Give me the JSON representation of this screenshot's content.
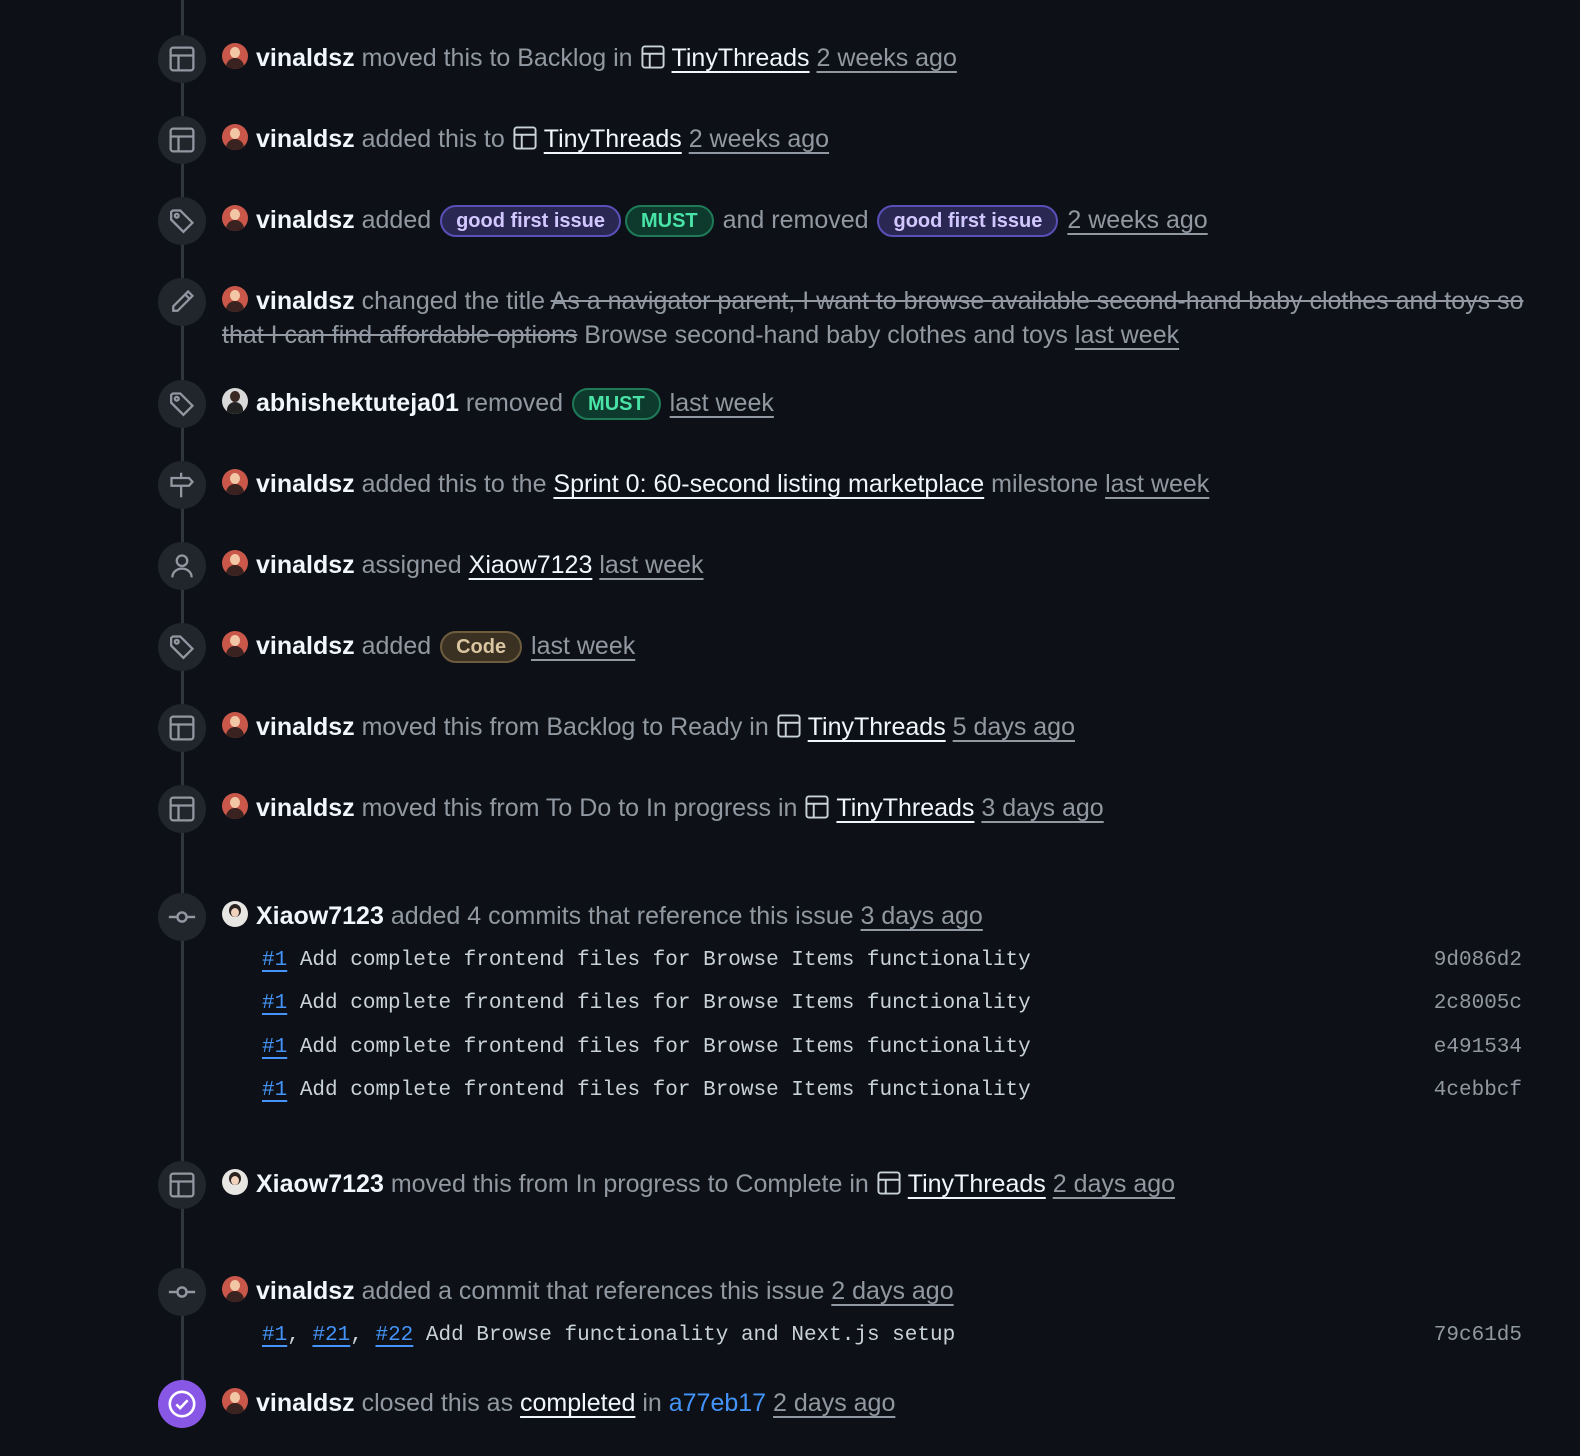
{
  "events": [
    {
      "user": "vinaldsz",
      "avatar": "v",
      "icon": "project",
      "parts": [
        {
          "t": "moved this to Backlog in "
        },
        {
          "p": "TinyThreads"
        },
        {
          "t": " "
        },
        {
          "time": "2 weeks ago"
        }
      ]
    },
    {
      "user": "vinaldsz",
      "avatar": "v",
      "icon": "project",
      "parts": [
        {
          "t": "added this to "
        },
        {
          "p": "TinyThreads"
        },
        {
          "t": " "
        },
        {
          "time": "2 weeks ago"
        }
      ]
    },
    {
      "user": "vinaldsz",
      "avatar": "v",
      "icon": "tag",
      "parts": [
        {
          "t": "added "
        },
        {
          "label": "good first issue",
          "c": "gfi"
        },
        {
          "label": "MUST",
          "c": "must"
        },
        {
          "t": " and removed "
        },
        {
          "label": "good first issue",
          "c": "gfi"
        },
        {
          "t": " "
        },
        {
          "time": "2 weeks ago"
        }
      ]
    },
    {
      "user": "vinaldsz",
      "avatar": "v",
      "icon": "pencil",
      "wrap": true,
      "parts": [
        {
          "t": "changed the title "
        },
        {
          "s": "As a navigator parent, I want to browse available second-hand baby clothes and toys so that I can find affordable options"
        },
        {
          "t": " Browse second-hand baby clothes and toys "
        },
        {
          "time": "last week"
        }
      ]
    },
    {
      "user": "abhishektuteja01",
      "avatar": "a",
      "icon": "tag",
      "parts": [
        {
          "t": "removed "
        },
        {
          "label": "MUST",
          "c": "must"
        },
        {
          "t": " "
        },
        {
          "time": "last week"
        }
      ]
    },
    {
      "user": "vinaldsz",
      "avatar": "v",
      "icon": "milestone",
      "parts": [
        {
          "t": "added this to the "
        },
        {
          "l": "Sprint 0: 60-second listing marketplace"
        },
        {
          "t": " milestone "
        },
        {
          "time": "last week"
        }
      ]
    },
    {
      "user": "vinaldsz",
      "avatar": "v",
      "icon": "person",
      "parts": [
        {
          "t": "assigned "
        },
        {
          "l": "Xiaow7123"
        },
        {
          "t": " "
        },
        {
          "time": "last week"
        }
      ]
    },
    {
      "user": "vinaldsz",
      "avatar": "v",
      "icon": "tag",
      "parts": [
        {
          "t": "added "
        },
        {
          "label": "Code",
          "c": "code"
        },
        {
          "t": " "
        },
        {
          "time": "last week"
        }
      ]
    },
    {
      "user": "vinaldsz",
      "avatar": "v",
      "icon": "project",
      "parts": [
        {
          "t": "moved this from Backlog to Ready in "
        },
        {
          "p": "TinyThreads"
        },
        {
          "t": " "
        },
        {
          "time": "5 days ago"
        }
      ]
    },
    {
      "user": "vinaldsz",
      "avatar": "v",
      "icon": "project",
      "parts": [
        {
          "t": "moved this from To Do to In progress in "
        },
        {
          "p": "TinyThreads"
        },
        {
          "t": " "
        },
        {
          "time": "3 days ago"
        }
      ]
    },
    {
      "user": "Xiaow7123",
      "avatar": "x",
      "icon": "commit",
      "parts": [
        {
          "t": "added 4 commits that reference this issue "
        },
        {
          "time": "3 days ago"
        }
      ]
    },
    {
      "user": "Xiaow7123",
      "avatar": "x",
      "icon": "project",
      "parts": [
        {
          "t": "moved this from In progress to Complete in "
        },
        {
          "p": "TinyThreads"
        },
        {
          "t": " "
        },
        {
          "time": "2 days ago"
        }
      ]
    },
    {
      "user": "vinaldsz",
      "avatar": "v",
      "icon": "commit",
      "parts": [
        {
          "t": "added a commit that references this issue "
        },
        {
          "time": "2 days ago"
        }
      ]
    },
    {
      "user": "vinaldsz",
      "avatar": "v",
      "icon": "closed",
      "parts": [
        {
          "t": "closed this as "
        },
        {
          "l": "completed"
        },
        {
          "t": " in "
        },
        {
          "b": "a77eb17"
        },
        {
          "t": " "
        },
        {
          "time": "2 days ago"
        }
      ]
    }
  ],
  "commits_group1": [
    {
      "refs": [
        "#1"
      ],
      "message": "Add complete frontend files for Browse Items functionality",
      "sha": "9d086d2"
    },
    {
      "refs": [
        "#1"
      ],
      "message": "Add complete frontend files for Browse Items functionality",
      "sha": "2c8005c"
    },
    {
      "refs": [
        "#1"
      ],
      "message": "Add complete frontend files for Browse Items functionality",
      "sha": "e491534"
    },
    {
      "refs": [
        "#1"
      ],
      "message": "Add complete frontend files for Browse Items functionality",
      "sha": "4cebbcf"
    }
  ],
  "commits_group2": [
    {
      "refs": [
        "#1",
        "#21",
        "#22"
      ],
      "message": "Add Browse functionality and Next.js setup",
      "sha": "79c61d5"
    }
  ]
}
